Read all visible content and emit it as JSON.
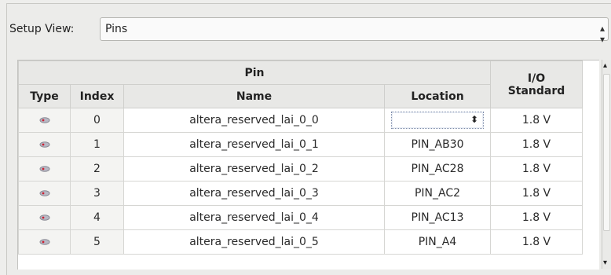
{
  "setup": {
    "label": "Setup View:",
    "value": "Pins"
  },
  "table": {
    "group_header": "Pin",
    "io_header": "I/O Standard",
    "columns": {
      "type": "Type",
      "index": "Index",
      "name": "Name",
      "location": "Location"
    },
    "rows": [
      {
        "index": "0",
        "name": "altera_reserved_lai_0_0",
        "location": "",
        "io": "1.8 V"
      },
      {
        "index": "1",
        "name": "altera_reserved_lai_0_1",
        "location": "PIN_AB30",
        "io": "1.8 V"
      },
      {
        "index": "2",
        "name": "altera_reserved_lai_0_2",
        "location": "PIN_AC28",
        "io": "1.8 V"
      },
      {
        "index": "3",
        "name": "altera_reserved_lai_0_3",
        "location": "PIN_AC2",
        "io": "1.8 V"
      },
      {
        "index": "4",
        "name": "altera_reserved_lai_0_4",
        "location": "PIN_AC13",
        "io": "1.8 V"
      },
      {
        "index": "5",
        "name": "altera_reserved_lai_0_5",
        "location": "PIN_A4",
        "io": "1.8 V"
      }
    ],
    "type_icon": "pin-type-icon"
  },
  "colors": {
    "header_bg": "#e8e8e6",
    "grid_line": "#d6d6d3"
  }
}
